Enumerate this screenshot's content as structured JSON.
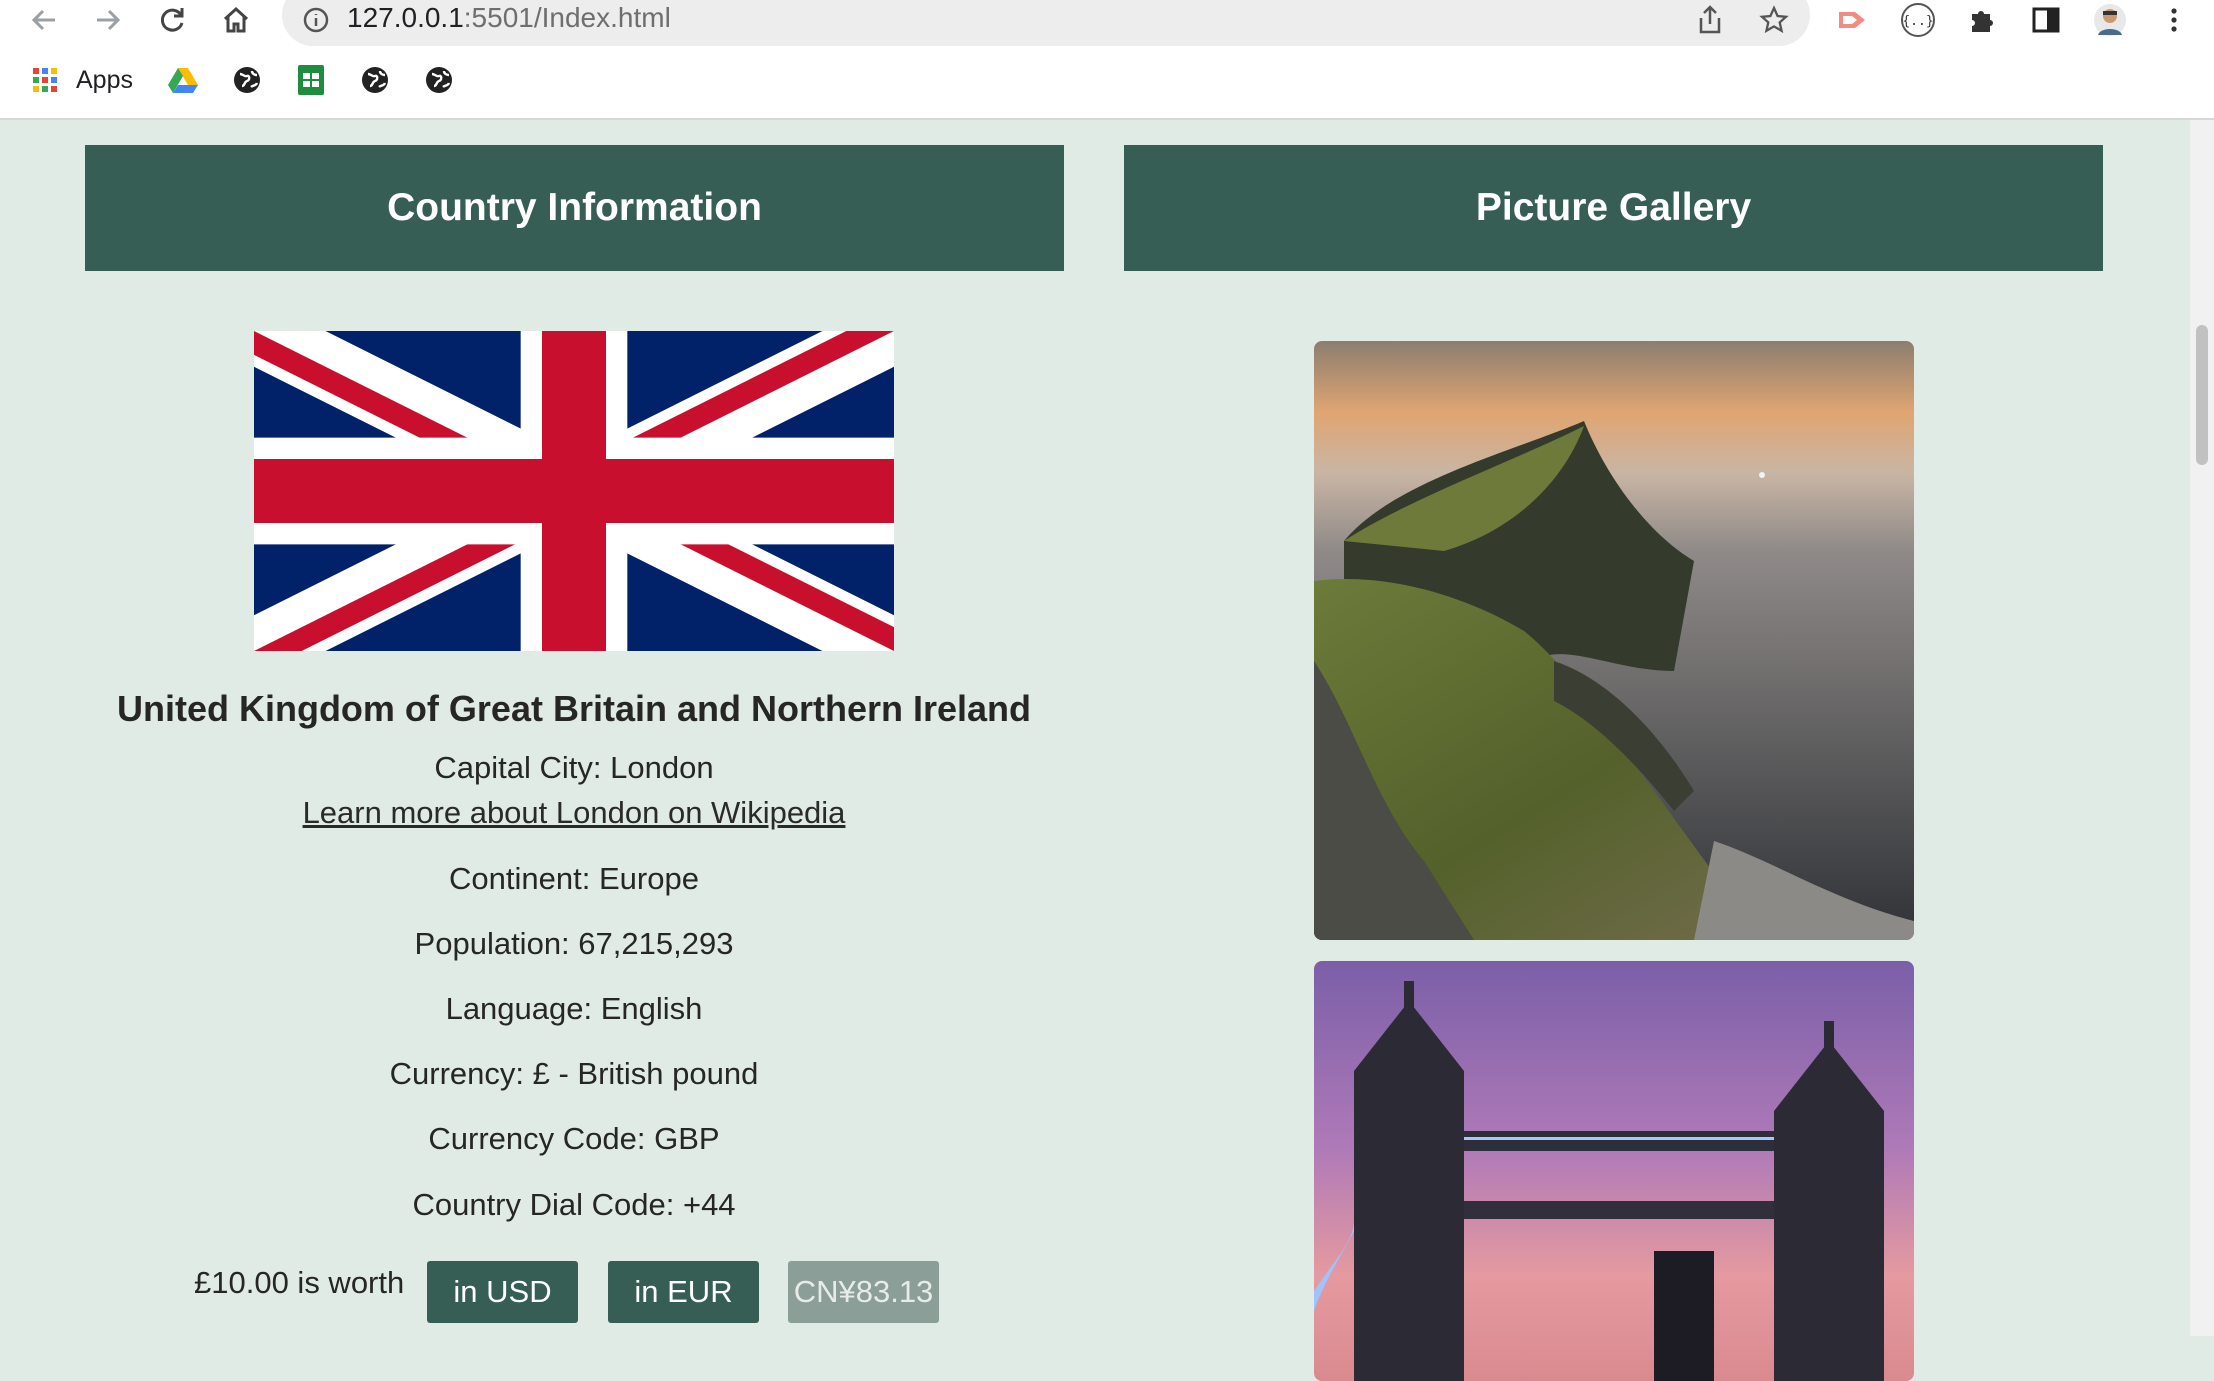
{
  "browser": {
    "url_host": "127.0.0.1",
    "url_rest": ":5501/Index.html",
    "bookmarks_apps_label": "Apps"
  },
  "panels": {
    "country_title": "Country Information",
    "gallery_title": "Picture Gallery"
  },
  "country": {
    "name": "United Kingdom of Great Britain and Northern Ireland",
    "capital": "Capital City: London",
    "wiki_link": "Learn more about London on Wikipedia",
    "continent": "Continent: Europe",
    "population": "Population: 67,215,293",
    "language": "Language: English",
    "currency": "Currency: £ - British pound",
    "currency_code": "Currency Code: GBP",
    "dial_code": "Country Dial Code: +44"
  },
  "converter": {
    "prefix": "£10.00 is worth",
    "usd_label": "in USD",
    "eur_label": "in EUR",
    "cny_result": "CN¥83.13"
  },
  "colors": {
    "header_green": "#365e55",
    "page_bg": "#e1ebe5"
  }
}
